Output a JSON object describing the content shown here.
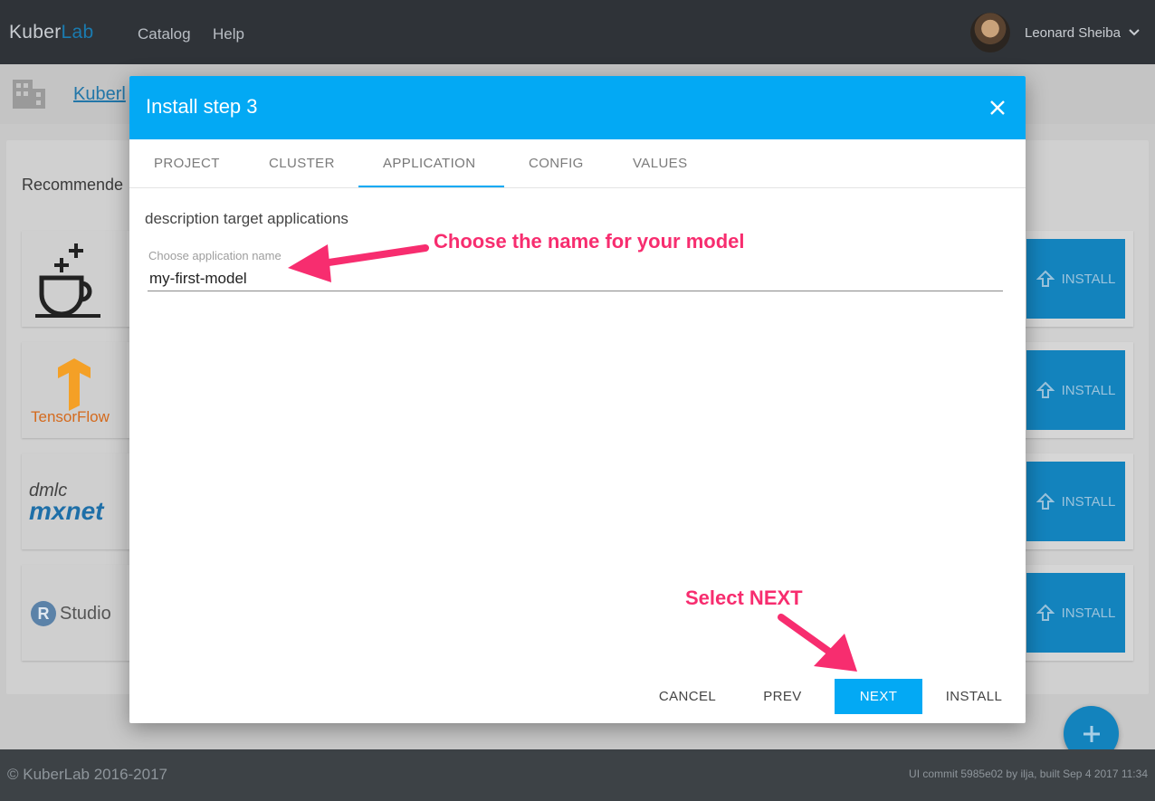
{
  "app": {
    "brand_main": "Kuber",
    "brand_accent": "Lab"
  },
  "nav": {
    "links": [
      "Catalog",
      "Help"
    ]
  },
  "user": {
    "name": "Leonard Sheiba"
  },
  "breadcrumb": {
    "label": "Kuberl"
  },
  "catalog": {
    "section_title": "Recommende",
    "install_label": "INSTALL",
    "cards": [
      {
        "logo": "coffee-plus-icon",
        "logo_text": ""
      },
      {
        "logo": "tensorflow-logo",
        "logo_text": "TensorFlow"
      },
      {
        "logo": "mxnet-logo",
        "logo_text_top": "dmlc",
        "logo_text_bottom": "mxnet"
      },
      {
        "logo": "rstudio-logo",
        "logo_text": "Studio",
        "badge": "R"
      }
    ]
  },
  "modal": {
    "title": "Install step 3",
    "tabs": [
      "PROJECT",
      "CLUSTER",
      "APPLICATION",
      "CONFIG",
      "VALUES"
    ],
    "active_tab": "APPLICATION",
    "description": "description target applications",
    "field": {
      "label": "Choose application name",
      "value": "my-first-model"
    },
    "buttons": {
      "cancel": "CANCEL",
      "prev": "PREV",
      "next": "NEXT",
      "install": "INSTALL"
    }
  },
  "annotations": {
    "name_hint": "Choose the name for your model",
    "next_hint": "Select NEXT"
  },
  "footer": {
    "copyright": "© KuberLab 2016-2017",
    "build": "UI commit 5985e02 by ilja, built Sep 4 2017 11:34"
  },
  "colors": {
    "accent": "#03a9f4",
    "topbar": "#2f3338",
    "annotation": "#f72d6f"
  }
}
